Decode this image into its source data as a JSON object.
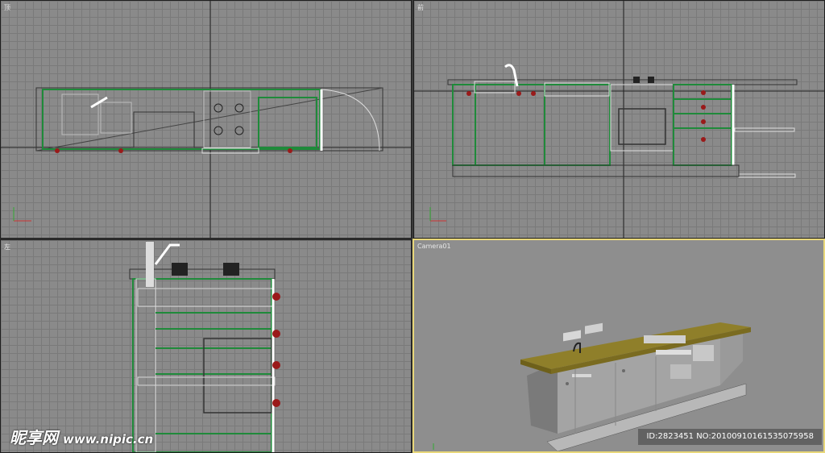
{
  "viewports": {
    "top": {
      "label": "顶"
    },
    "front": {
      "label": "前"
    },
    "left": {
      "label": "左"
    },
    "camera": {
      "label": "Camera01"
    }
  },
  "watermark": {
    "brand": "昵享网",
    "url": "www.nipic.cn"
  },
  "image_id": {
    "text": "ID:2823451 NO:20100910161535075958"
  },
  "colors": {
    "grid_bg": "#8a8a8a",
    "camera_bg": "#8e8e8e",
    "wire_green": "#1f8a3a",
    "wire_white": "#ffffff",
    "knob_red": "#9a1a1a",
    "countertop": "#8f7f2a",
    "active_border": "#e8d77a"
  }
}
